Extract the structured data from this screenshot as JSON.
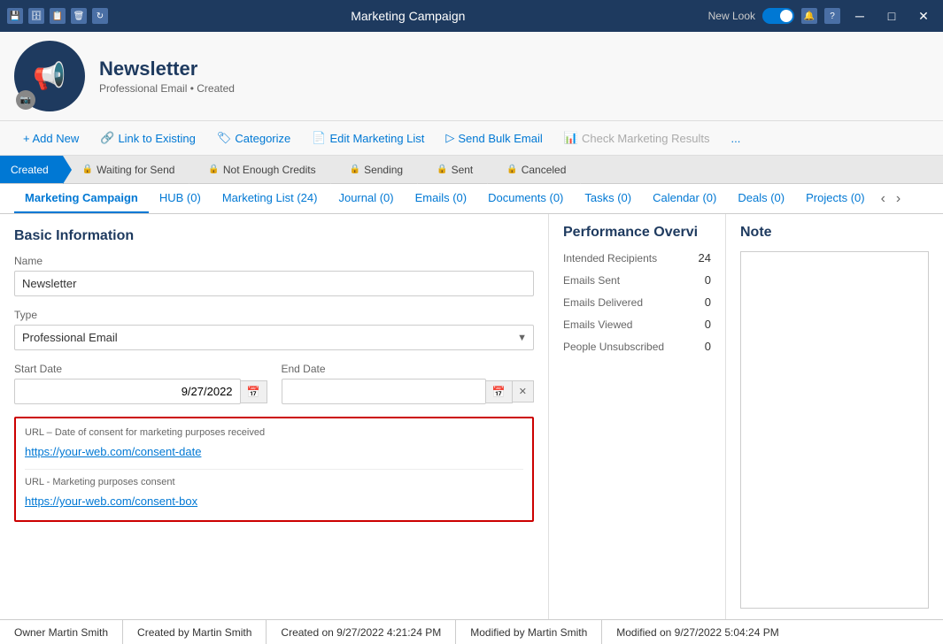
{
  "titlebar": {
    "title": "Marketing Campaign",
    "new_look": "New Look",
    "icons": [
      "save-all",
      "save",
      "save-as",
      "delete",
      "refresh"
    ],
    "win_btns": [
      "minimize",
      "maximize",
      "close"
    ]
  },
  "header": {
    "name": "Newsletter",
    "subtitle": "Professional Email • Created"
  },
  "toolbar": {
    "add_new": "+ Add New",
    "link_to_existing": "Link to Existing",
    "categorize": "Categorize",
    "edit_marketing_list": "Edit Marketing List",
    "send_bulk_email": "Send Bulk Email",
    "check_marketing_results": "Check Marketing Results",
    "more": "..."
  },
  "status_steps": [
    {
      "label": "Created",
      "active": true,
      "locked": false
    },
    {
      "label": "Waiting for Send",
      "active": false,
      "locked": true
    },
    {
      "label": "Not Enough Credits",
      "active": false,
      "locked": true
    },
    {
      "label": "Sending",
      "active": false,
      "locked": true
    },
    {
      "label": "Sent",
      "active": false,
      "locked": true
    },
    {
      "label": "Canceled",
      "active": false,
      "locked": true
    }
  ],
  "tabs": [
    {
      "label": "Marketing Campaign",
      "active": true,
      "count": null
    },
    {
      "label": "HUB (0)",
      "active": false
    },
    {
      "label": "Marketing List (24)",
      "active": false
    },
    {
      "label": "Journal (0)",
      "active": false
    },
    {
      "label": "Emails (0)",
      "active": false
    },
    {
      "label": "Documents (0)",
      "active": false
    },
    {
      "label": "Tasks (0)",
      "active": false
    },
    {
      "label": "Calendar (0)",
      "active": false
    },
    {
      "label": "Deals (0)",
      "active": false
    },
    {
      "label": "Projects (0)",
      "active": false
    }
  ],
  "basic_info": {
    "title": "Basic Information",
    "name_label": "Name",
    "name_value": "Newsletter",
    "type_label": "Type",
    "type_value": "Professional Email",
    "start_date_label": "Start Date",
    "start_date_value": "9/27/2022",
    "end_date_label": "End Date",
    "end_date_value": "",
    "url1_label": "URL – Date of consent for marketing purposes received",
    "url1_value": "https://your-web.com/consent-date",
    "url2_label": "URL - Marketing purposes consent",
    "url2_value": "https://your-web.com/consent-box"
  },
  "performance": {
    "title": "Performance Overvi",
    "rows": [
      {
        "label": "Intended Recipients",
        "value": "24"
      },
      {
        "label": "Emails Sent",
        "value": "0"
      },
      {
        "label": "Emails Delivered",
        "value": "0"
      },
      {
        "label": "Emails Viewed",
        "value": "0"
      },
      {
        "label": "People Unsubscribed",
        "value": "0"
      }
    ]
  },
  "note": {
    "title": "Note"
  },
  "footer": {
    "owner": "Owner  Martin Smith",
    "created_by": "Created by  Martin Smith",
    "created_on": "Created on  9/27/2022 4:21:24 PM",
    "modified_by": "Modified by  Martin Smith",
    "modified_on": "Modified on  9/27/2022 5:04:24 PM"
  }
}
